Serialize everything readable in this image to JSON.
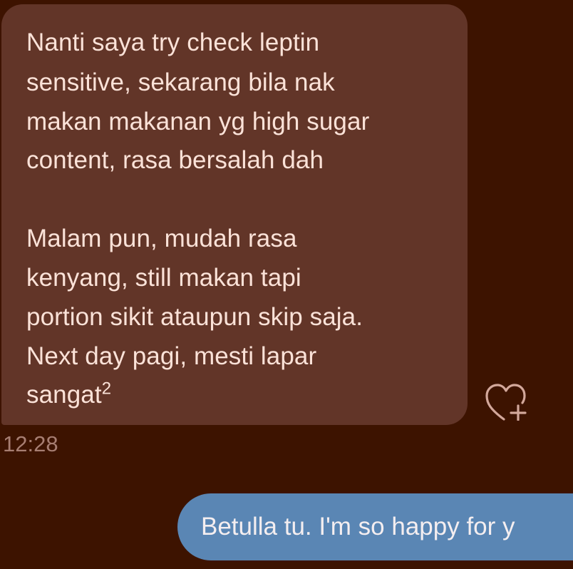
{
  "conversation": {
    "received_message": {
      "lines": [
        "Nanti saya try check leptin",
        "sensitive, sekarang bila nak",
        "makan makanan yg high sugar",
        "content, rasa bersalah dah",
        "Malam pun, mudah rasa",
        "kenyang, still makan tapi",
        "portion sikit ataupun skip saja.",
        "Next day pagi, mesti lapar",
        "sangat"
      ],
      "superscript": "2",
      "timestamp": "12:28"
    },
    "like_icon": "heart-plus-icon",
    "sent_message": {
      "text": "Betulla tu. I'm so happy for y"
    }
  },
  "colors": {
    "background": "#3d1300",
    "received_bubble": "#623528",
    "received_text": "#fbe2d8",
    "timestamp": "#a77e72",
    "sent_bubble": "#5a86b4",
    "sent_text": "#f4eef0",
    "icon": "#d3a89b"
  }
}
